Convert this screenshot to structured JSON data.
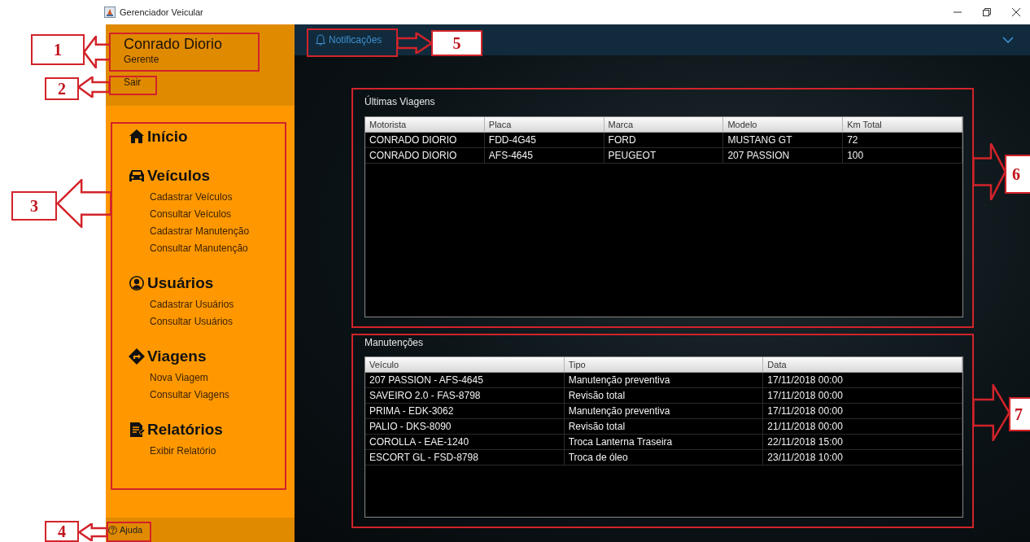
{
  "window": {
    "title": "Gerenciador Veicular"
  },
  "user": {
    "name": "Conrado Diorio",
    "role": "Gerente",
    "logout": "Sair"
  },
  "menu": [
    {
      "kind": "home",
      "label": "Início"
    },
    {
      "kind": "car",
      "label": "Veículos",
      "items": [
        "Cadastrar Veículos",
        "Consultar Veículos",
        "Cadastrar Manutenção",
        "Consultar Manutenção"
      ]
    },
    {
      "kind": "user",
      "label": "Usuários",
      "items": [
        "Cadastrar Usuários",
        "Consultar Usuários"
      ]
    },
    {
      "kind": "route",
      "label": "Viagens",
      "items": [
        "Nova Viagem",
        "Consultar Viagens"
      ]
    },
    {
      "kind": "report",
      "label": "Relatórios",
      "items": [
        "Exibir Relatório"
      ]
    }
  ],
  "help": "Ajuda",
  "topbar": {
    "notifications": "Notificações"
  },
  "trips": {
    "title": "Últimas Viagens",
    "columns": [
      "Motorista",
      "Placa",
      "Marca",
      "Modelo",
      "Km Total"
    ],
    "rows": [
      [
        "CONRADO DIORIO",
        "FDD-4G45",
        "FORD",
        "MUSTANG GT",
        "72"
      ],
      [
        "CONRADO DIORIO",
        "AFS-4645",
        "PEUGEOT",
        "207 PASSION",
        "100"
      ]
    ]
  },
  "maintenance": {
    "title": "Manutenções",
    "columns": [
      "Veículo",
      "Tipo",
      "Data"
    ],
    "rows": [
      [
        "207 PASSION - AFS-4645",
        "Manutenção preventiva",
        "17/11/2018 00:00"
      ],
      [
        "SAVEIRO 2.0 - FAS-8798",
        "Revisão total",
        "17/11/2018 00:00"
      ],
      [
        "PRIMA - EDK-3062",
        "Manutenção preventiva",
        "17/11/2018 00:00"
      ],
      [
        "PALIO - DKS-8090",
        "Revisão total",
        "21/11/2018 00:00"
      ],
      [
        "COROLLA - EAE-1240",
        "Troca Lanterna Traseira",
        "22/11/2018 15:00"
      ],
      [
        "ESCORT GL - FSD-8798",
        "Troca de óleo",
        "23/11/2018 10:00"
      ]
    ]
  },
  "annotations": [
    {
      "label": "1",
      "kind": "left"
    },
    {
      "label": "2",
      "kind": "left"
    },
    {
      "label": "3",
      "kind": "left"
    },
    {
      "label": "4",
      "kind": "left"
    },
    {
      "label": "5",
      "kind": "right"
    },
    {
      "label": "6",
      "kind": "right"
    },
    {
      "label": "7",
      "kind": "right"
    }
  ]
}
